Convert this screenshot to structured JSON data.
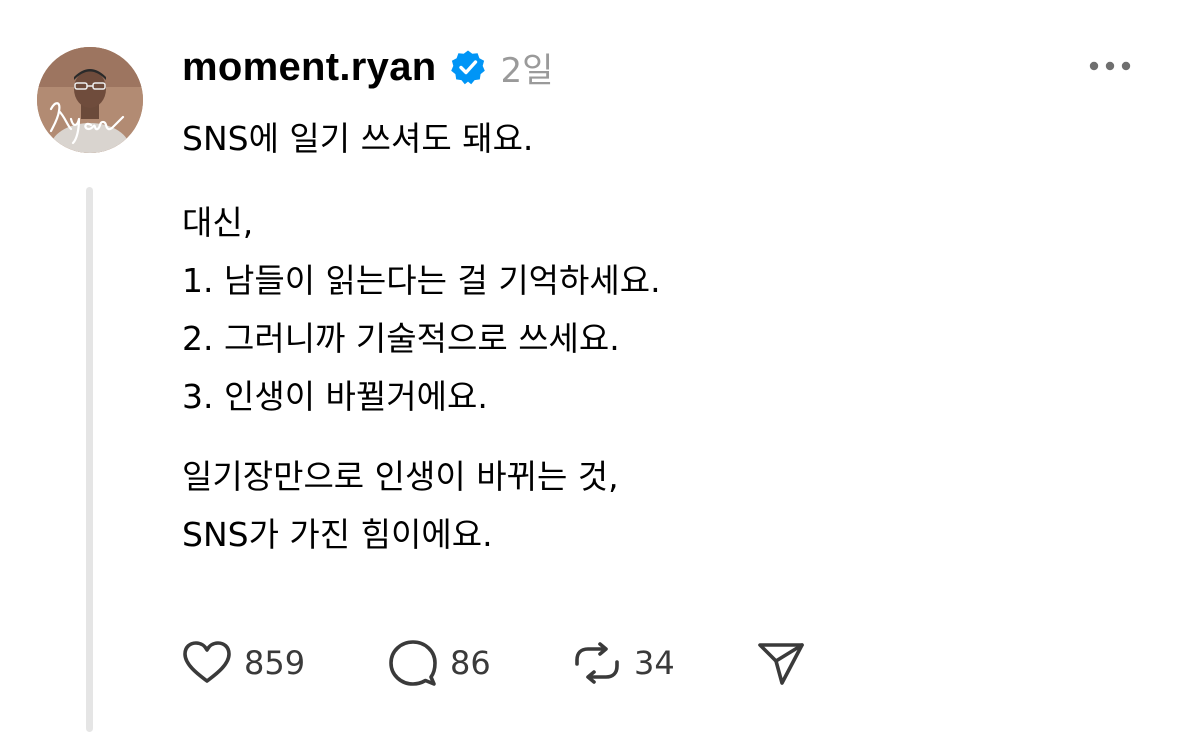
{
  "post": {
    "author": {
      "username": "moment.ryan",
      "verified": true,
      "avatar_signature": "Ryan"
    },
    "time": "2일",
    "paragraphs": [
      [
        "SNS에 일기 쓰셔도 돼요."
      ],
      [
        "대신,",
        "1. 남들이 읽는다는 걸 기억하세요.",
        "2. 그러니까 기술적으로 쓰세요.",
        "3. 인생이 바뀔거에요."
      ],
      [
        "일기장만으로 인생이 바뀌는 것,",
        "SNS가 가진 힘이에요."
      ]
    ],
    "stats": {
      "likes": "859",
      "replies": "86",
      "reposts": "34"
    }
  },
  "icons": {
    "verified": "verified-badge-icon",
    "more": "more-horizontal-icon",
    "like": "heart-icon",
    "reply": "comment-bubble-icon",
    "repost": "repost-arrows-icon",
    "share": "send-paper-plane-icon"
  },
  "colors": {
    "verified_badge": "#0095f6",
    "timestamp": "#9a9a9a",
    "icon": "#3a3a3a",
    "thread_line": "#e5e5e5"
  }
}
